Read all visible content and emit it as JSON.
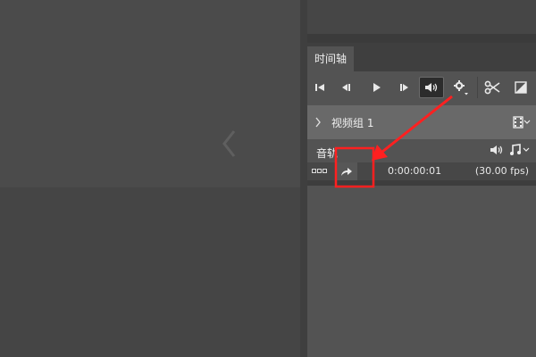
{
  "timeline_panel": {
    "tab_label": "时间轴",
    "video_group_label": "视频组 1",
    "audio_track_label": "音轨",
    "timecode": "0:00:00:01",
    "frame_rate": "(30.00 fps)"
  },
  "icons": {
    "first_frame": "skip-to-first-frame-icon",
    "prev_frame": "previous-frame-icon",
    "play": "play-icon",
    "next_frame": "next-frame-icon",
    "mute": "speaker-icon",
    "settings": "gear-icon",
    "split": "scissors-icon",
    "transition": "transition-icon",
    "render": "render-video-icon",
    "film": "film-strip-icon",
    "music": "music-note-icon"
  },
  "colors": {
    "highlight": "#ff2020",
    "panel": "#535353",
    "video_group": "#696969"
  }
}
